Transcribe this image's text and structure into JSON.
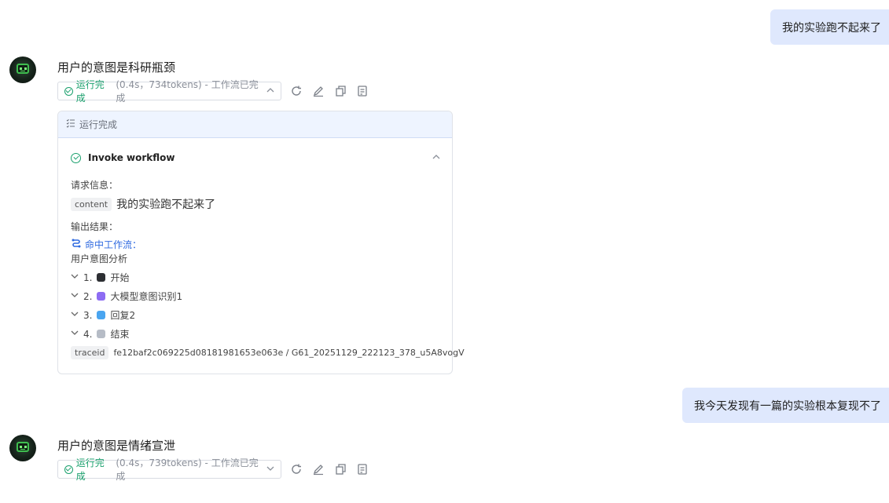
{
  "conversation": {
    "user_message_1": "我的实验跑不起来了",
    "bot_reply_1": {
      "title": "用户的意图是科研瓶颈",
      "status": {
        "ok_label": "运行完成",
        "meta": "(0.4s，734tokens) - 工作流已完成"
      }
    },
    "run_card": {
      "header": "运行完成",
      "workflow_name": "Invoke workflow",
      "request_label": "请求信息：",
      "content_tag": "content",
      "content_value": "我的实验跑不起来了",
      "output_label": "输出结果：",
      "hit_workflow_label": "命中工作流：",
      "hit_workflow_value": "用户意图分析",
      "steps": [
        {
          "num": "1.",
          "label": "开始",
          "color": "#2d2f33"
        },
        {
          "num": "2.",
          "label": "大模型意图识别1",
          "color": "#8d6cf3"
        },
        {
          "num": "3.",
          "label": "回复2",
          "color": "#4aa5f0"
        },
        {
          "num": "4.",
          "label": "结束",
          "color": "#b6bcc6"
        }
      ],
      "traceid_tag": "traceid",
      "traceid_value": "fe12baf2c069225d08181981653e063e / G61_20251129_222123_378_u5A8vogV"
    },
    "user_message_2": "我今天发现有一篇的实验根本复现不了",
    "bot_reply_2": {
      "title": "用户的意图是情绪宣泄",
      "status": {
        "ok_label": "运行完成",
        "meta": "(0.4s，739tokens) - 工作流已完成"
      }
    }
  },
  "colors": {
    "user_bubble": "#dfe8fd",
    "success": "#1aa06d",
    "link": "#2f6ae0",
    "card_header": "#eef4ff"
  },
  "icons": [
    "check-circle-icon",
    "chevron-up-icon",
    "chevron-down-icon",
    "refresh-icon",
    "edit-icon",
    "copy-icon",
    "notes-icon",
    "list-icon",
    "workflow-icon"
  ]
}
